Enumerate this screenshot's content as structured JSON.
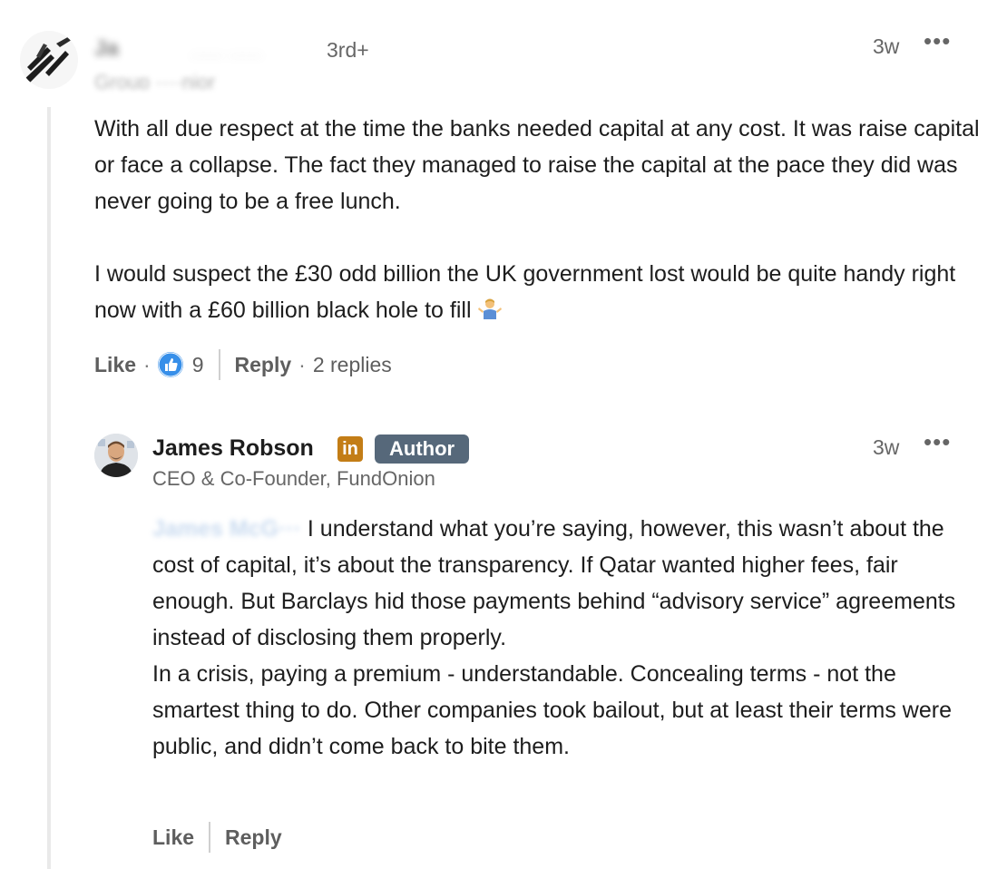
{
  "comment": {
    "author_name": "Ja",
    "author_name_redacted": "····· ·····",
    "degree": "3rd+",
    "headline": "Group ····nior",
    "timestamp": "3w",
    "more_label": "•••",
    "paragraph_1": "With all due respect at the time the banks needed capital at any cost. It was raise capital or face a collapse. The fact they managed to raise the capital at the pace they did was never going to be a free lunch.",
    "paragraph_2": "I would suspect the £30 odd billion the UK government lost would be quite handy right now with a £60 billion black hole to fill",
    "emoji": "person-shrugging-emoji",
    "like_label": "Like",
    "reaction_count": "9",
    "reply_label": "Reply",
    "replies_label": "2 replies"
  },
  "reply": {
    "author_name": "James Robson",
    "linkedin_badge": "in",
    "author_badge": "Author",
    "headline": "CEO & Co-Founder, FundOnion",
    "timestamp": "3w",
    "more_label": "•••",
    "mention": "James McG···",
    "paragraph_1": "I understand what you’re saying, however, this wasn’t about the cost of capital, it’s about the transparency. If Qatar wanted higher fees, fair enough. But Barclays hid those payments behind “advisory service” agreements instead of disclosing them properly.",
    "paragraph_2": "In a crisis, paying a premium - understandable. Concealing terms - not the smartest thing to do. Other companies took bailout, but at least their terms were public, and didn’t come back to bite them.",
    "like_label": "Like",
    "reply_label": "Reply"
  },
  "colors": {
    "like_blue": "#378fe9",
    "author_badge_bg": "#56687a",
    "linkedin_badge_bg": "#c37d16",
    "muted_text": "#666666"
  }
}
